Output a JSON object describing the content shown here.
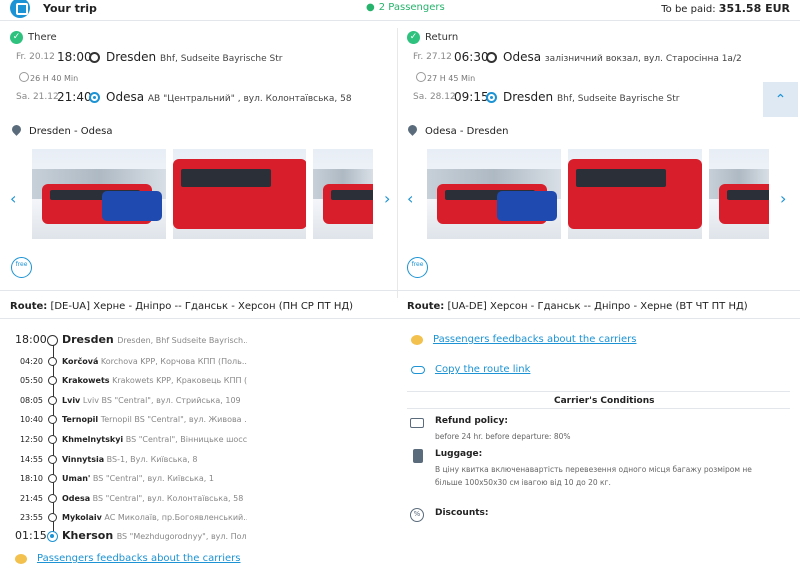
{
  "header": {
    "title": "Your trip",
    "passengers": "2 Passengers",
    "pay_label": "To be paid:",
    "pay_value": "351.58 EUR"
  },
  "there": {
    "label": "There",
    "dep_date": "Fr. 20.12",
    "dep_time": "18:00",
    "dep_city": "Dresden",
    "dep_place": "Bhf, Sudseite Bayrische Str",
    "duration": "26 H 40 Min",
    "arr_date": "Sa. 21.12",
    "arr_time": "21:40",
    "arr_city": "Odesa",
    "arr_place": "АВ \"Центральний\" , вул. Колонтаївська, 58",
    "route_name": "Dresden - Odesa",
    "route_label": "Route:",
    "route_text": "[DE-UA] Херне - Дніпро -- Гданськ - Херсон (ПН СР ПТ НД)",
    "wifi": "free"
  },
  "return": {
    "label": "Return",
    "dep_date": "Fr. 27.12",
    "dep_time": "06:30",
    "dep_city": "Odesa",
    "dep_place": "залізничний вокзал, вул. Старосінна 1а/2",
    "duration": "27 H 45 Min",
    "arr_date": "Sa. 28.12",
    "arr_time": "09:15",
    "arr_city": "Dresden",
    "arr_place": "Bhf, Sudseite Bayrische Str",
    "route_name": "Odesa - Dresden",
    "route_label": "Route:",
    "route_text": "[UA-DE] Херсон - Гданськ -- Дніпро - Херне (ВТ ЧТ ПТ НД)",
    "wifi": "free"
  },
  "stops": [
    {
      "time": "18:00",
      "city": "Dresden",
      "place": "Dresden, Bhf Sudseite Bayrisch..."
    },
    {
      "time": "04:20",
      "city": "Korčová",
      "place": "Korchova KPP, Корчова КПП (Поль..."
    },
    {
      "time": "05:50",
      "city": "Krakowets",
      "place": "Krakowets KPP, Краковець КПП (..."
    },
    {
      "time": "08:05",
      "city": "Lviv",
      "place": "Lviv BS \"Central\", вул. Стрийська, 109"
    },
    {
      "time": "10:40",
      "city": "Ternopil",
      "place": "Ternopil BS \"Central\", вул. Живова ..."
    },
    {
      "time": "12:50",
      "city": "Khmelnytskyi",
      "place": "BS \"Central\", Вінницьке шосс..."
    },
    {
      "time": "14:55",
      "city": "Vinnytsia",
      "place": "BS-1, Вул. Київська, 8"
    },
    {
      "time": "18:10",
      "city": "Uman'",
      "place": "BS \"Central\", вул. Київська, 1"
    },
    {
      "time": "21:45",
      "city": "Odesa",
      "place": "BS \"Central\", вул. Колонтаївська, 58"
    },
    {
      "time": "23:55",
      "city": "Mykolaiv",
      "place": "AC Миколаїв, пр.Богоявленський..."
    },
    {
      "time": "01:15",
      "city": "Kherson",
      "place": "BS \"Mezhdugorodnyy\", вул. Пол..."
    }
  ],
  "links": {
    "feedback_left": "Passengers feedbacks about the carriers",
    "feedback_right": "Passengers feedbacks about the carriers",
    "copy_route": "Copy the route link"
  },
  "conditions": {
    "title": "Carrier's Conditions",
    "refund_h": "Refund policy:",
    "refund_d": "before 24 hr. before departure: 80%",
    "luggage_h": "Luggage:",
    "luggage_d": "В ціну квитка включенавартість перевезення одного місця багажу розміром не більше 100х50х30 см івагою від 10 до 20 кг.",
    "discounts_h": "Discounts:",
    "discounts_icon": "%"
  }
}
